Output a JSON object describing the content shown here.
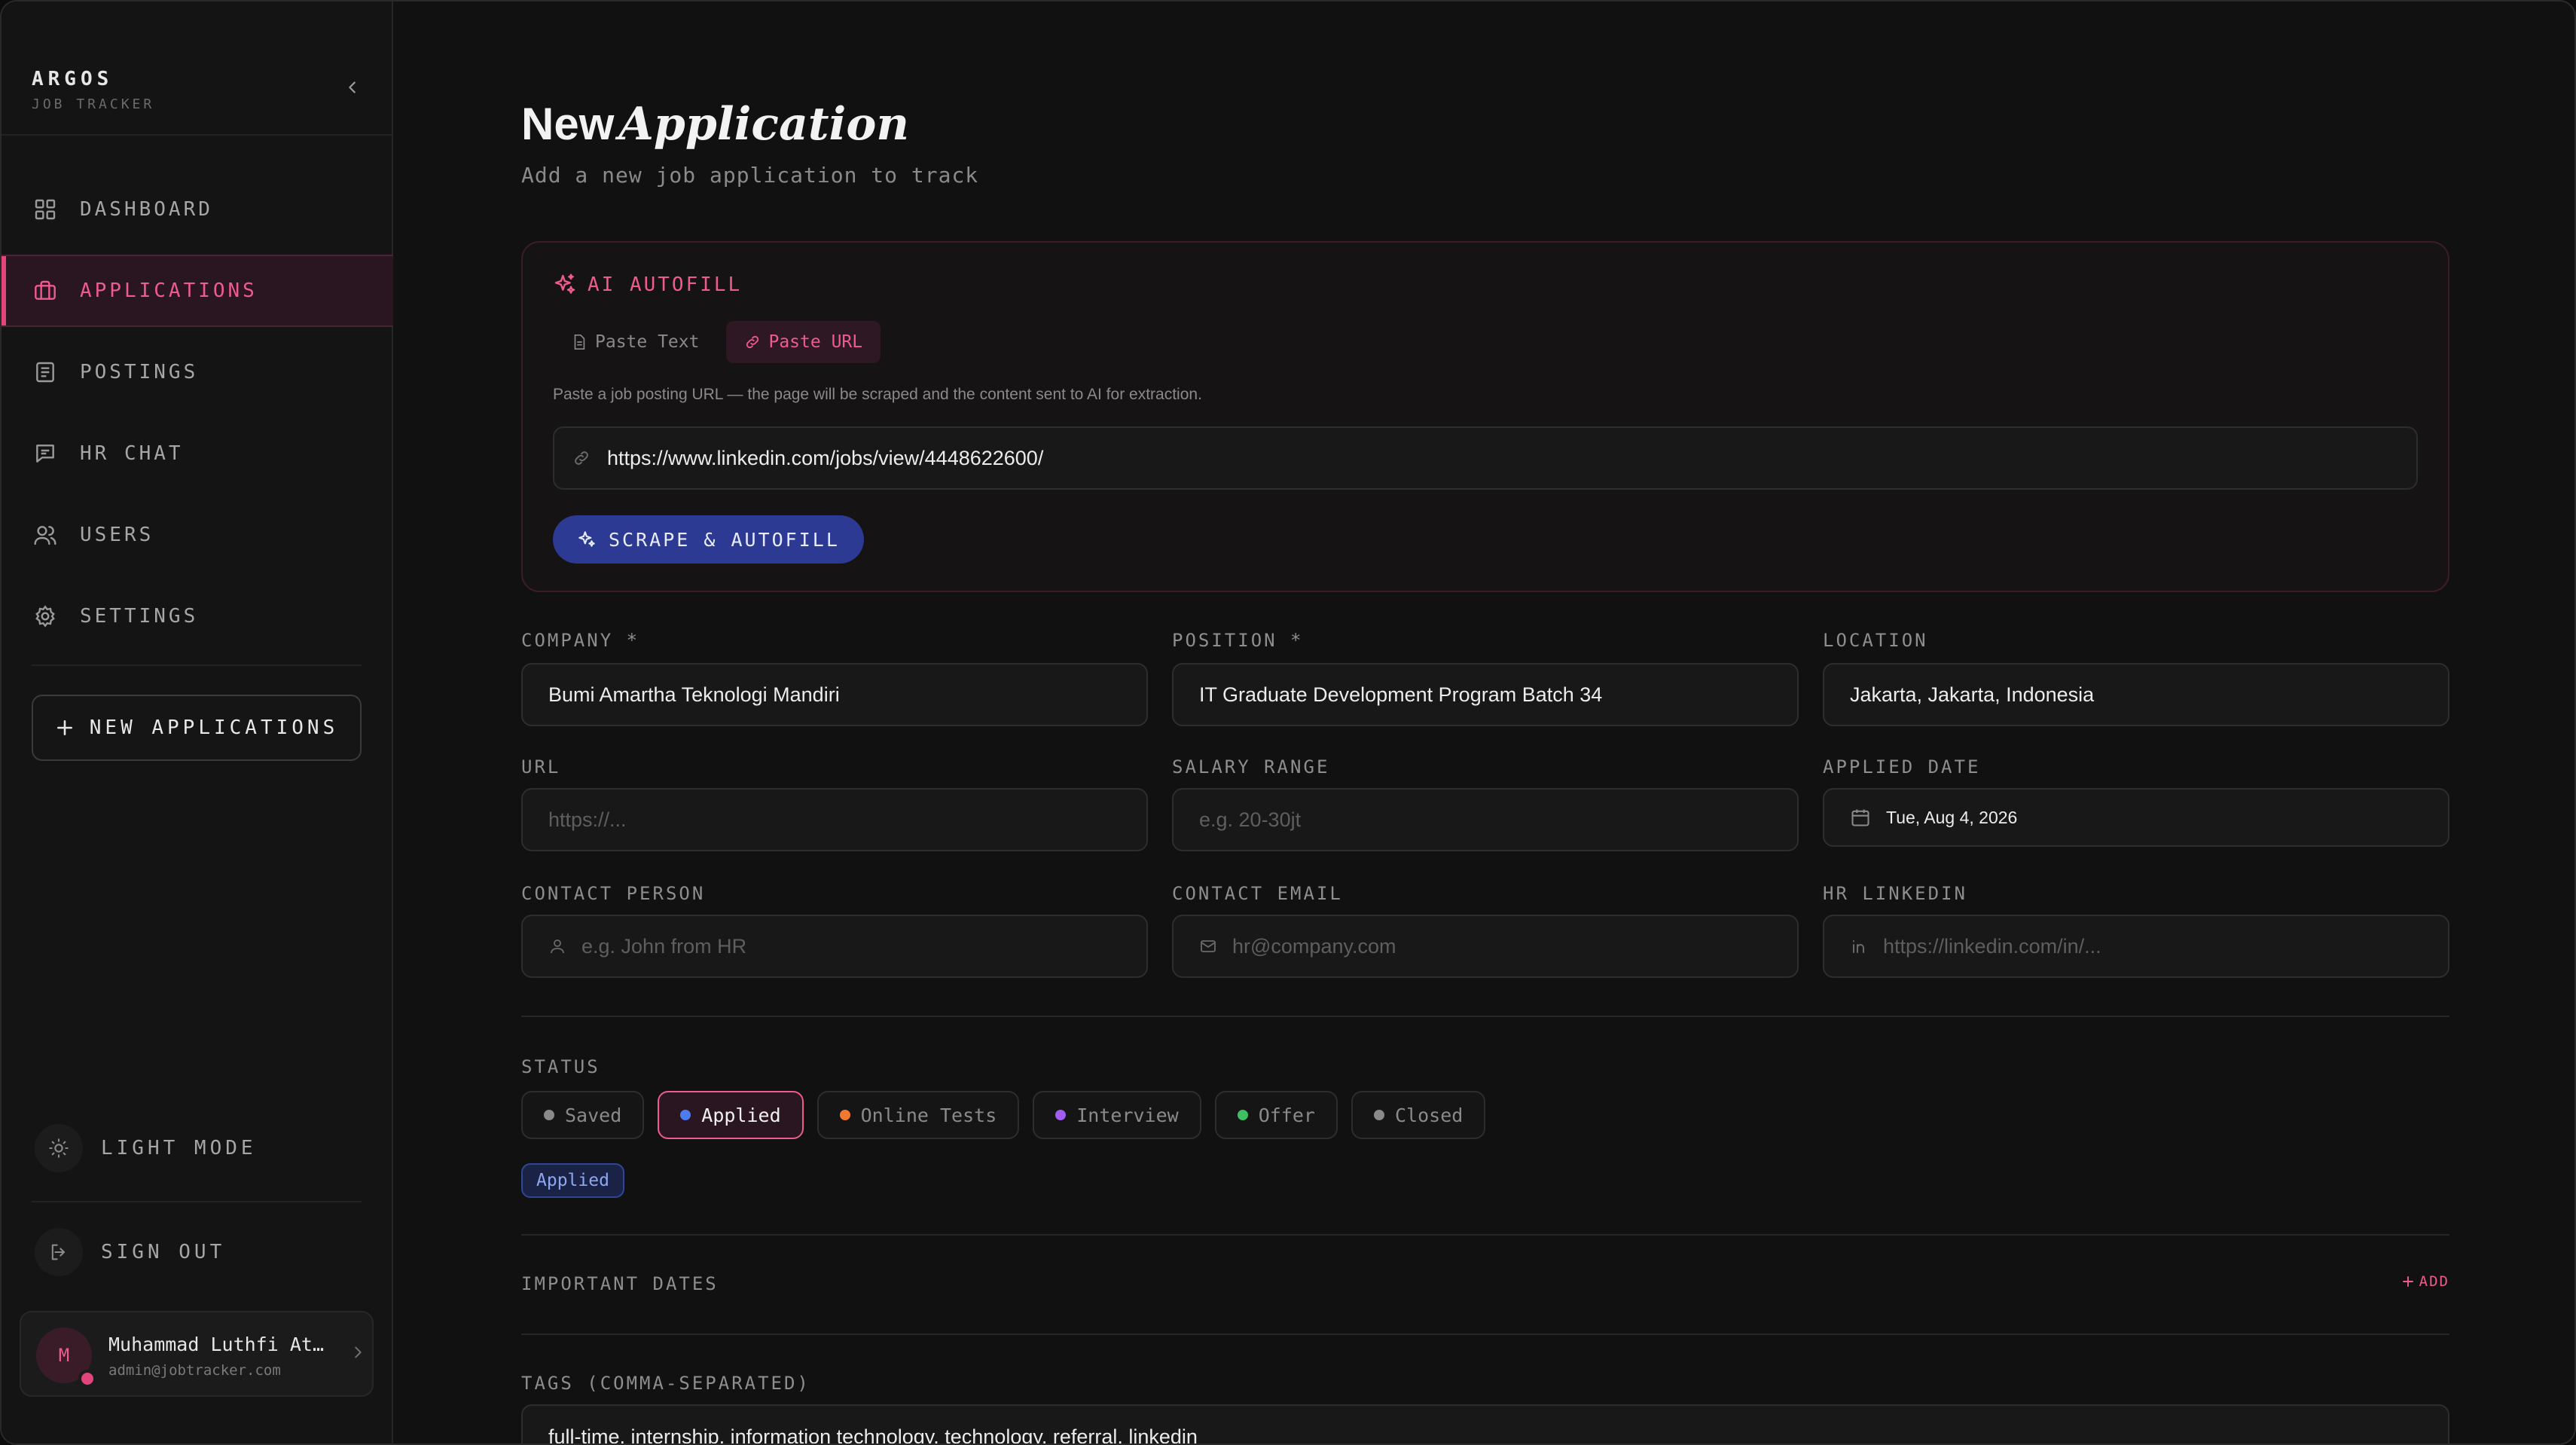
{
  "brand": {
    "title": "ARGOS",
    "subtitle": "JOB TRACKER"
  },
  "sidebar": {
    "items": [
      {
        "label": "DASHBOARD",
        "icon": "grid-icon",
        "active": false
      },
      {
        "label": "APPLICATIONS",
        "icon": "briefcase-icon",
        "active": true
      },
      {
        "label": "POSTINGS",
        "icon": "document-icon",
        "active": false
      },
      {
        "label": "HR CHAT",
        "icon": "chat-icon",
        "active": false
      },
      {
        "label": "USERS",
        "icon": "users-icon",
        "active": false
      },
      {
        "label": "SETTINGS",
        "icon": "gear-icon",
        "active": false
      }
    ],
    "new_button": "NEW APPLICATIONS",
    "light_mode": "LIGHT MODE",
    "sign_out": "SIGN OUT",
    "user": {
      "initial": "M",
      "name": "Muhammad Luthfi At...",
      "email": "admin@jobtracker.com"
    }
  },
  "page": {
    "title_plain": "New",
    "title_italic": "Application",
    "subtitle": "Add a new job application to track"
  },
  "ai": {
    "heading": "AI AUTOFILL",
    "tabs": [
      {
        "label": "Paste Text",
        "active": false
      },
      {
        "label": "Paste URL",
        "active": true
      }
    ],
    "hint": "Paste a job posting URL — the page will be scraped and the content sent to AI for extraction.",
    "url_value": "https://www.linkedin.com/jobs/view/4448622600/",
    "button": "SCRAPE & AUTOFILL"
  },
  "form": {
    "company": {
      "label": "COMPANY *",
      "value": "Bumi Amartha Teknologi Mandiri"
    },
    "position": {
      "label": "POSITION *",
      "value": "IT Graduate Development Program Batch 34"
    },
    "location": {
      "label": "LOCATION",
      "value": "Jakarta, Jakarta, Indonesia"
    },
    "url": {
      "label": "URL",
      "placeholder": "https://..."
    },
    "salary": {
      "label": "SALARY RANGE",
      "placeholder": "e.g. 20-30jt"
    },
    "applied_date": {
      "label": "APPLIED DATE",
      "value": "Tue, Aug 4, 2026"
    },
    "contact_person": {
      "label": "CONTACT PERSON",
      "placeholder": "e.g. John from HR"
    },
    "contact_email": {
      "label": "CONTACT EMAIL",
      "placeholder": "hr@company.com"
    },
    "hr_linkedin": {
      "label": "HR LINKEDIN",
      "placeholder": "https://linkedin.com/in/..."
    }
  },
  "status": {
    "label": "STATUS",
    "options": [
      {
        "label": "Saved",
        "color": "#8a8a8a",
        "active": false
      },
      {
        "label": "Applied",
        "color": "#4d7cf0",
        "active": true
      },
      {
        "label": "Online Tests",
        "color": "#ef7a2e",
        "active": false
      },
      {
        "label": "Interview",
        "color": "#a35cf0",
        "active": false
      },
      {
        "label": "Offer",
        "color": "#3fbf62",
        "active": false
      },
      {
        "label": "Closed",
        "color": "#8a8a8a",
        "active": false
      }
    ],
    "current": "Applied"
  },
  "important_dates": {
    "label": "IMPORTANT DATES",
    "add": "ADD"
  },
  "tags": {
    "label": "TAGS (COMMA-SEPARATED)",
    "value": "full-time, internship, information technology, technology, referral, linkedin"
  }
}
